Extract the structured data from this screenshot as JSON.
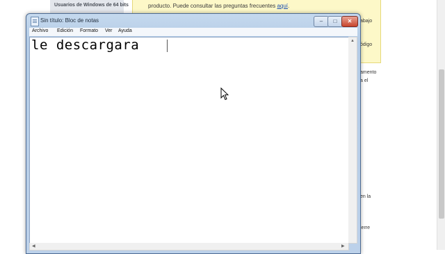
{
  "background_page": {
    "sidebar_item": "Usuarios de Windows de 64 bits",
    "notice_text": "producto. Puede consultar las preguntas frecuentes ",
    "notice_link": "aquí",
    "notice_end": ".",
    "fragments": {
      "f1": "abajo",
      "f2": "ódigo",
      "f3": "amento",
      "f4": "a el",
      "f5": "en la",
      "f6": "ierre"
    }
  },
  "notepad": {
    "title": "Sin título: Bloc de notas",
    "controls": {
      "minimize": "–",
      "maximize": "□",
      "close": "✕"
    },
    "menu": [
      "Archivo",
      "Edición",
      "Formato",
      "Ver",
      "Ayuda"
    ],
    "content": "le descargara "
  },
  "icons": {
    "app": "notepad-icon",
    "cursor": "mouse-pointer-icon",
    "scroll_up": "arrow-up-icon",
    "scroll_left": "arrow-left-icon",
    "scroll_right": "arrow-right-icon"
  }
}
